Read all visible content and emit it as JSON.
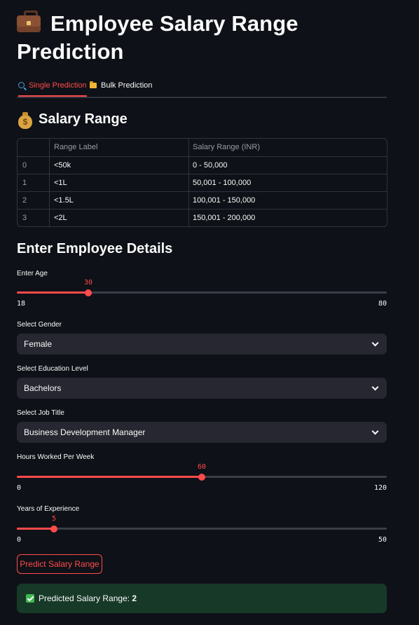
{
  "title": "Employee Salary Range Prediction",
  "tabs": [
    {
      "label": "Single Prediction",
      "icon": "magnifier-icon",
      "active": true
    },
    {
      "label": "Bulk Prediction",
      "icon": "folder-icon",
      "active": false
    }
  ],
  "salary_section": {
    "heading": "Salary Range",
    "icon": "money-bag-icon",
    "columns": [
      "Range Label",
      "Salary Range (INR)"
    ],
    "rows": [
      {
        "index": "0",
        "label": "<50k",
        "range": "0 - 50,000"
      },
      {
        "index": "1",
        "label": "<1L",
        "range": "50,001 - 100,000"
      },
      {
        "index": "2",
        "label": "<1.5L",
        "range": "100,001 - 150,000"
      },
      {
        "index": "3",
        "label": "<2L",
        "range": "150,001 - 200,000"
      }
    ]
  },
  "form": {
    "heading": "Enter Employee Details",
    "age": {
      "label": "Enter Age",
      "value": "30",
      "min": "18",
      "max": "80"
    },
    "gender": {
      "label": "Select Gender",
      "value": "Female"
    },
    "education": {
      "label": "Select Education Level",
      "value": "Bachelors"
    },
    "job_title": {
      "label": "Select Job Title",
      "value": "Business Development Manager"
    },
    "hours": {
      "label": "Hours Worked Per Week",
      "value": "60",
      "min": "0",
      "max": "120"
    },
    "experience": {
      "label": "Years of Experience",
      "value": "5",
      "min": "0",
      "max": "50"
    },
    "predict_button": "Predict Salary Range"
  },
  "result": {
    "prefix": "Predicted Salary Range: ",
    "value": "2"
  },
  "colors": {
    "background": "#0e1117",
    "accent": "#ff4b4b",
    "input_bg": "#262730",
    "success_bg": "#173928"
  }
}
